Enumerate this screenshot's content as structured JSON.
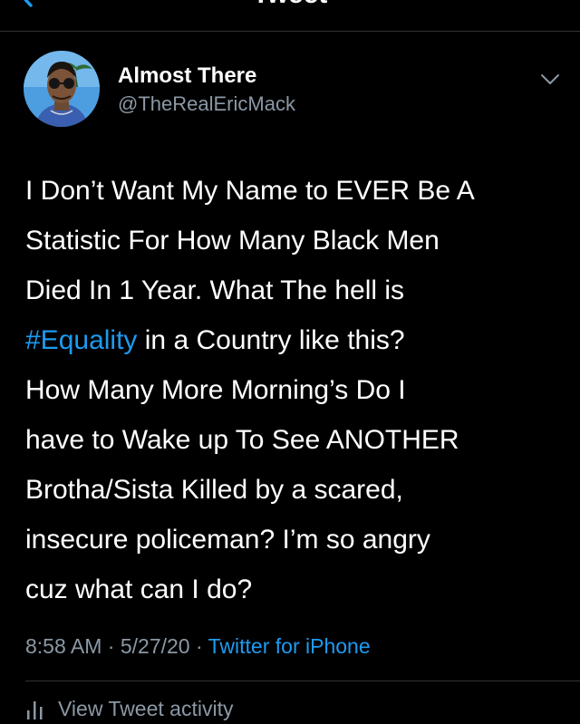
{
  "header": {
    "title": "Tweet",
    "back_icon": "chevron-left-icon"
  },
  "author": {
    "display_name": "Almost There",
    "handle": "@TheRealEricMack",
    "avatar_icon": "profile-avatar",
    "menu_icon": "chevron-down-icon"
  },
  "tweet": {
    "lines": [
      "I Don’t Want My Name to EVER Be A",
      "Statistic For How Many Black Men",
      "Died In 1 Year. What The hell is",
      "in a Country like this?",
      "How Many More Morning’s Do I",
      "have to Wake up To See ANOTHER",
      "Brotha/Sista Killed by a scared,",
      "insecure policeman? I’m so angry",
      "cuz what can I do?"
    ],
    "hashtag": "#Equality"
  },
  "meta": {
    "time": "8:58 AM",
    "separator": "·",
    "date": "5/27/20",
    "source": "Twitter for iPhone"
  },
  "activity": {
    "label": "View Tweet activity",
    "icon": "bar-chart-icon"
  },
  "colors": {
    "background": "#000000",
    "text": "#ffffff",
    "secondary_text": "#8b98a5",
    "link": "#1d9bf0",
    "divider": "#2f3336"
  }
}
